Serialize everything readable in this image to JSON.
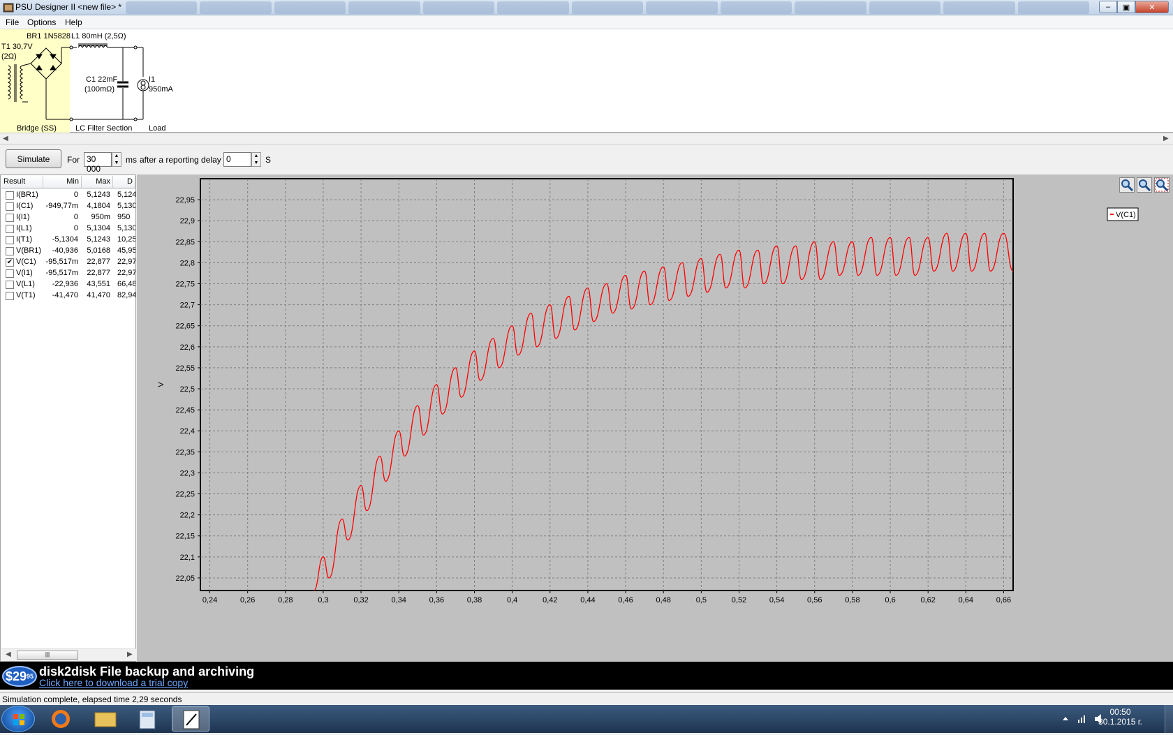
{
  "window": {
    "title": "PSU Designer II  <new file> *"
  },
  "menu": [
    "File",
    "Options",
    "Help"
  ],
  "circuit": {
    "transformer": "T1 30,7V",
    "transformer_r": "(2Ω)",
    "bridge": "BR1 1N5828",
    "inductor": "L1 80mH (2,5Ω)",
    "capacitor": "C1 22mF",
    "capacitor_r": "(100mΩ)",
    "load": "I1",
    "load_current": "950mA",
    "section_bridge": "Bridge (SS)",
    "section_lc": "LC Filter Section",
    "section_load": "Load"
  },
  "simbar": {
    "simulate_label": "Simulate",
    "for_label": "For",
    "duration_value": "30 000",
    "duration_unit": "ms",
    "delay_label": "after a reporting delay of",
    "delay_value": "0",
    "delay_unit": "S"
  },
  "results": {
    "headers": [
      "Result",
      "Min",
      "Max",
      "D"
    ],
    "rows": [
      {
        "name": "I(BR1)",
        "min": "0",
        "max": "5,1243",
        "d": "5,124",
        "checked": false
      },
      {
        "name": "I(C1)",
        "min": "-949,77m",
        "max": "4,1804",
        "d": "5,130",
        "checked": false
      },
      {
        "name": "I(I1)",
        "min": "0",
        "max": "950m",
        "d": "950",
        "checked": false
      },
      {
        "name": "I(L1)",
        "min": "0",
        "max": "5,1304",
        "d": "5,130",
        "checked": false
      },
      {
        "name": "I(T1)",
        "min": "-5,1304",
        "max": "5,1243",
        "d": "10,25",
        "checked": false
      },
      {
        "name": "V(BR1)",
        "min": "-40,936",
        "max": "5,0168",
        "d": "45,95",
        "checked": false
      },
      {
        "name": "V(C1)",
        "min": "-95,517m",
        "max": "22,877",
        "d": "22,97",
        "checked": true
      },
      {
        "name": "V(I1)",
        "min": "-95,517m",
        "max": "22,877",
        "d": "22,97",
        "checked": false
      },
      {
        "name": "V(L1)",
        "min": "-22,936",
        "max": "43,551",
        "d": "66,48",
        "checked": false
      },
      {
        "name": "V(T1)",
        "min": "-41,470",
        "max": "41,470",
        "d": "82,94",
        "checked": false
      }
    ]
  },
  "chart_data": {
    "type": "line",
    "ylabel": "V",
    "xlim": [
      0.235,
      0.665
    ],
    "ylim": [
      22.02,
      23.0
    ],
    "x_ticks": [
      "0,24",
      "0,26",
      "0,28",
      "0,3",
      "0,32",
      "0,34",
      "0,36",
      "0,38",
      "0,4",
      "0,42",
      "0,44",
      "0,46",
      "0,48",
      "0,5",
      "0,52",
      "0,54",
      "0,56",
      "0,58",
      "0,6",
      "0,62",
      "0,64",
      "0,66"
    ],
    "x_tick_values": [
      0.24,
      0.26,
      0.28,
      0.3,
      0.32,
      0.34,
      0.36,
      0.38,
      0.4,
      0.42,
      0.44,
      0.46,
      0.48,
      0.5,
      0.52,
      0.54,
      0.56,
      0.58,
      0.6,
      0.62,
      0.64,
      0.66
    ],
    "y_ticks": [
      "22,05",
      "22,1",
      "22,15",
      "22,2",
      "22,25",
      "22,3",
      "22,35",
      "22,4",
      "22,45",
      "22,5",
      "22,55",
      "22,6",
      "22,65",
      "22,7",
      "22,75",
      "22,8",
      "22,85",
      "22,9",
      "22,95"
    ],
    "y_tick_values": [
      22.05,
      22.1,
      22.15,
      22.2,
      22.25,
      22.3,
      22.35,
      22.4,
      22.45,
      22.5,
      22.55,
      22.6,
      22.65,
      22.7,
      22.75,
      22.8,
      22.85,
      22.9,
      22.95
    ],
    "grid": true,
    "legend": "top-right",
    "series": [
      {
        "name": "V(C1)",
        "color": "#ff0000",
        "x": [
          0.295,
          0.3,
          0.303,
          0.31,
          0.313,
          0.32,
          0.323,
          0.33,
          0.333,
          0.34,
          0.343,
          0.35,
          0.353,
          0.36,
          0.363,
          0.37,
          0.373,
          0.38,
          0.383,
          0.39,
          0.393,
          0.4,
          0.403,
          0.41,
          0.413,
          0.42,
          0.423,
          0.43,
          0.433,
          0.44,
          0.443,
          0.45,
          0.453,
          0.46,
          0.463,
          0.47,
          0.473,
          0.48,
          0.483,
          0.49,
          0.493,
          0.5,
          0.503,
          0.51,
          0.513,
          0.52,
          0.523,
          0.53,
          0.533,
          0.54,
          0.543,
          0.55,
          0.553,
          0.56,
          0.563,
          0.57,
          0.573,
          0.58,
          0.583,
          0.59,
          0.593,
          0.6,
          0.603,
          0.61,
          0.613,
          0.62,
          0.623,
          0.63,
          0.633,
          0.64,
          0.643,
          0.65,
          0.653,
          0.66,
          0.665
        ],
        "y": [
          22.02,
          22.1,
          22.05,
          22.19,
          22.14,
          22.27,
          22.21,
          22.34,
          22.28,
          22.4,
          22.34,
          22.46,
          22.39,
          22.51,
          22.44,
          22.55,
          22.48,
          22.59,
          22.52,
          22.62,
          22.55,
          22.65,
          22.58,
          22.68,
          22.6,
          22.7,
          22.62,
          22.72,
          22.64,
          22.74,
          22.66,
          22.75,
          22.68,
          22.77,
          22.69,
          22.78,
          22.7,
          22.79,
          22.71,
          22.8,
          22.72,
          22.81,
          22.73,
          22.82,
          22.74,
          22.83,
          22.74,
          22.83,
          22.75,
          22.84,
          22.75,
          22.84,
          22.76,
          22.85,
          22.76,
          22.85,
          22.77,
          22.85,
          22.77,
          22.86,
          22.77,
          22.86,
          22.77,
          22.86,
          22.77,
          22.86,
          22.78,
          22.87,
          22.78,
          22.87,
          22.78,
          22.87,
          22.78,
          22.87,
          22.78
        ]
      }
    ]
  },
  "banner": {
    "price": "$29",
    "price_cents": "95",
    "title": "disk2disk File backup and archiving",
    "link": "Click here to download a trial copy"
  },
  "status": "Simulation complete, elapsed time 2,29 seconds",
  "clock": {
    "time": "00:50",
    "date": "30.1.2015 г."
  }
}
